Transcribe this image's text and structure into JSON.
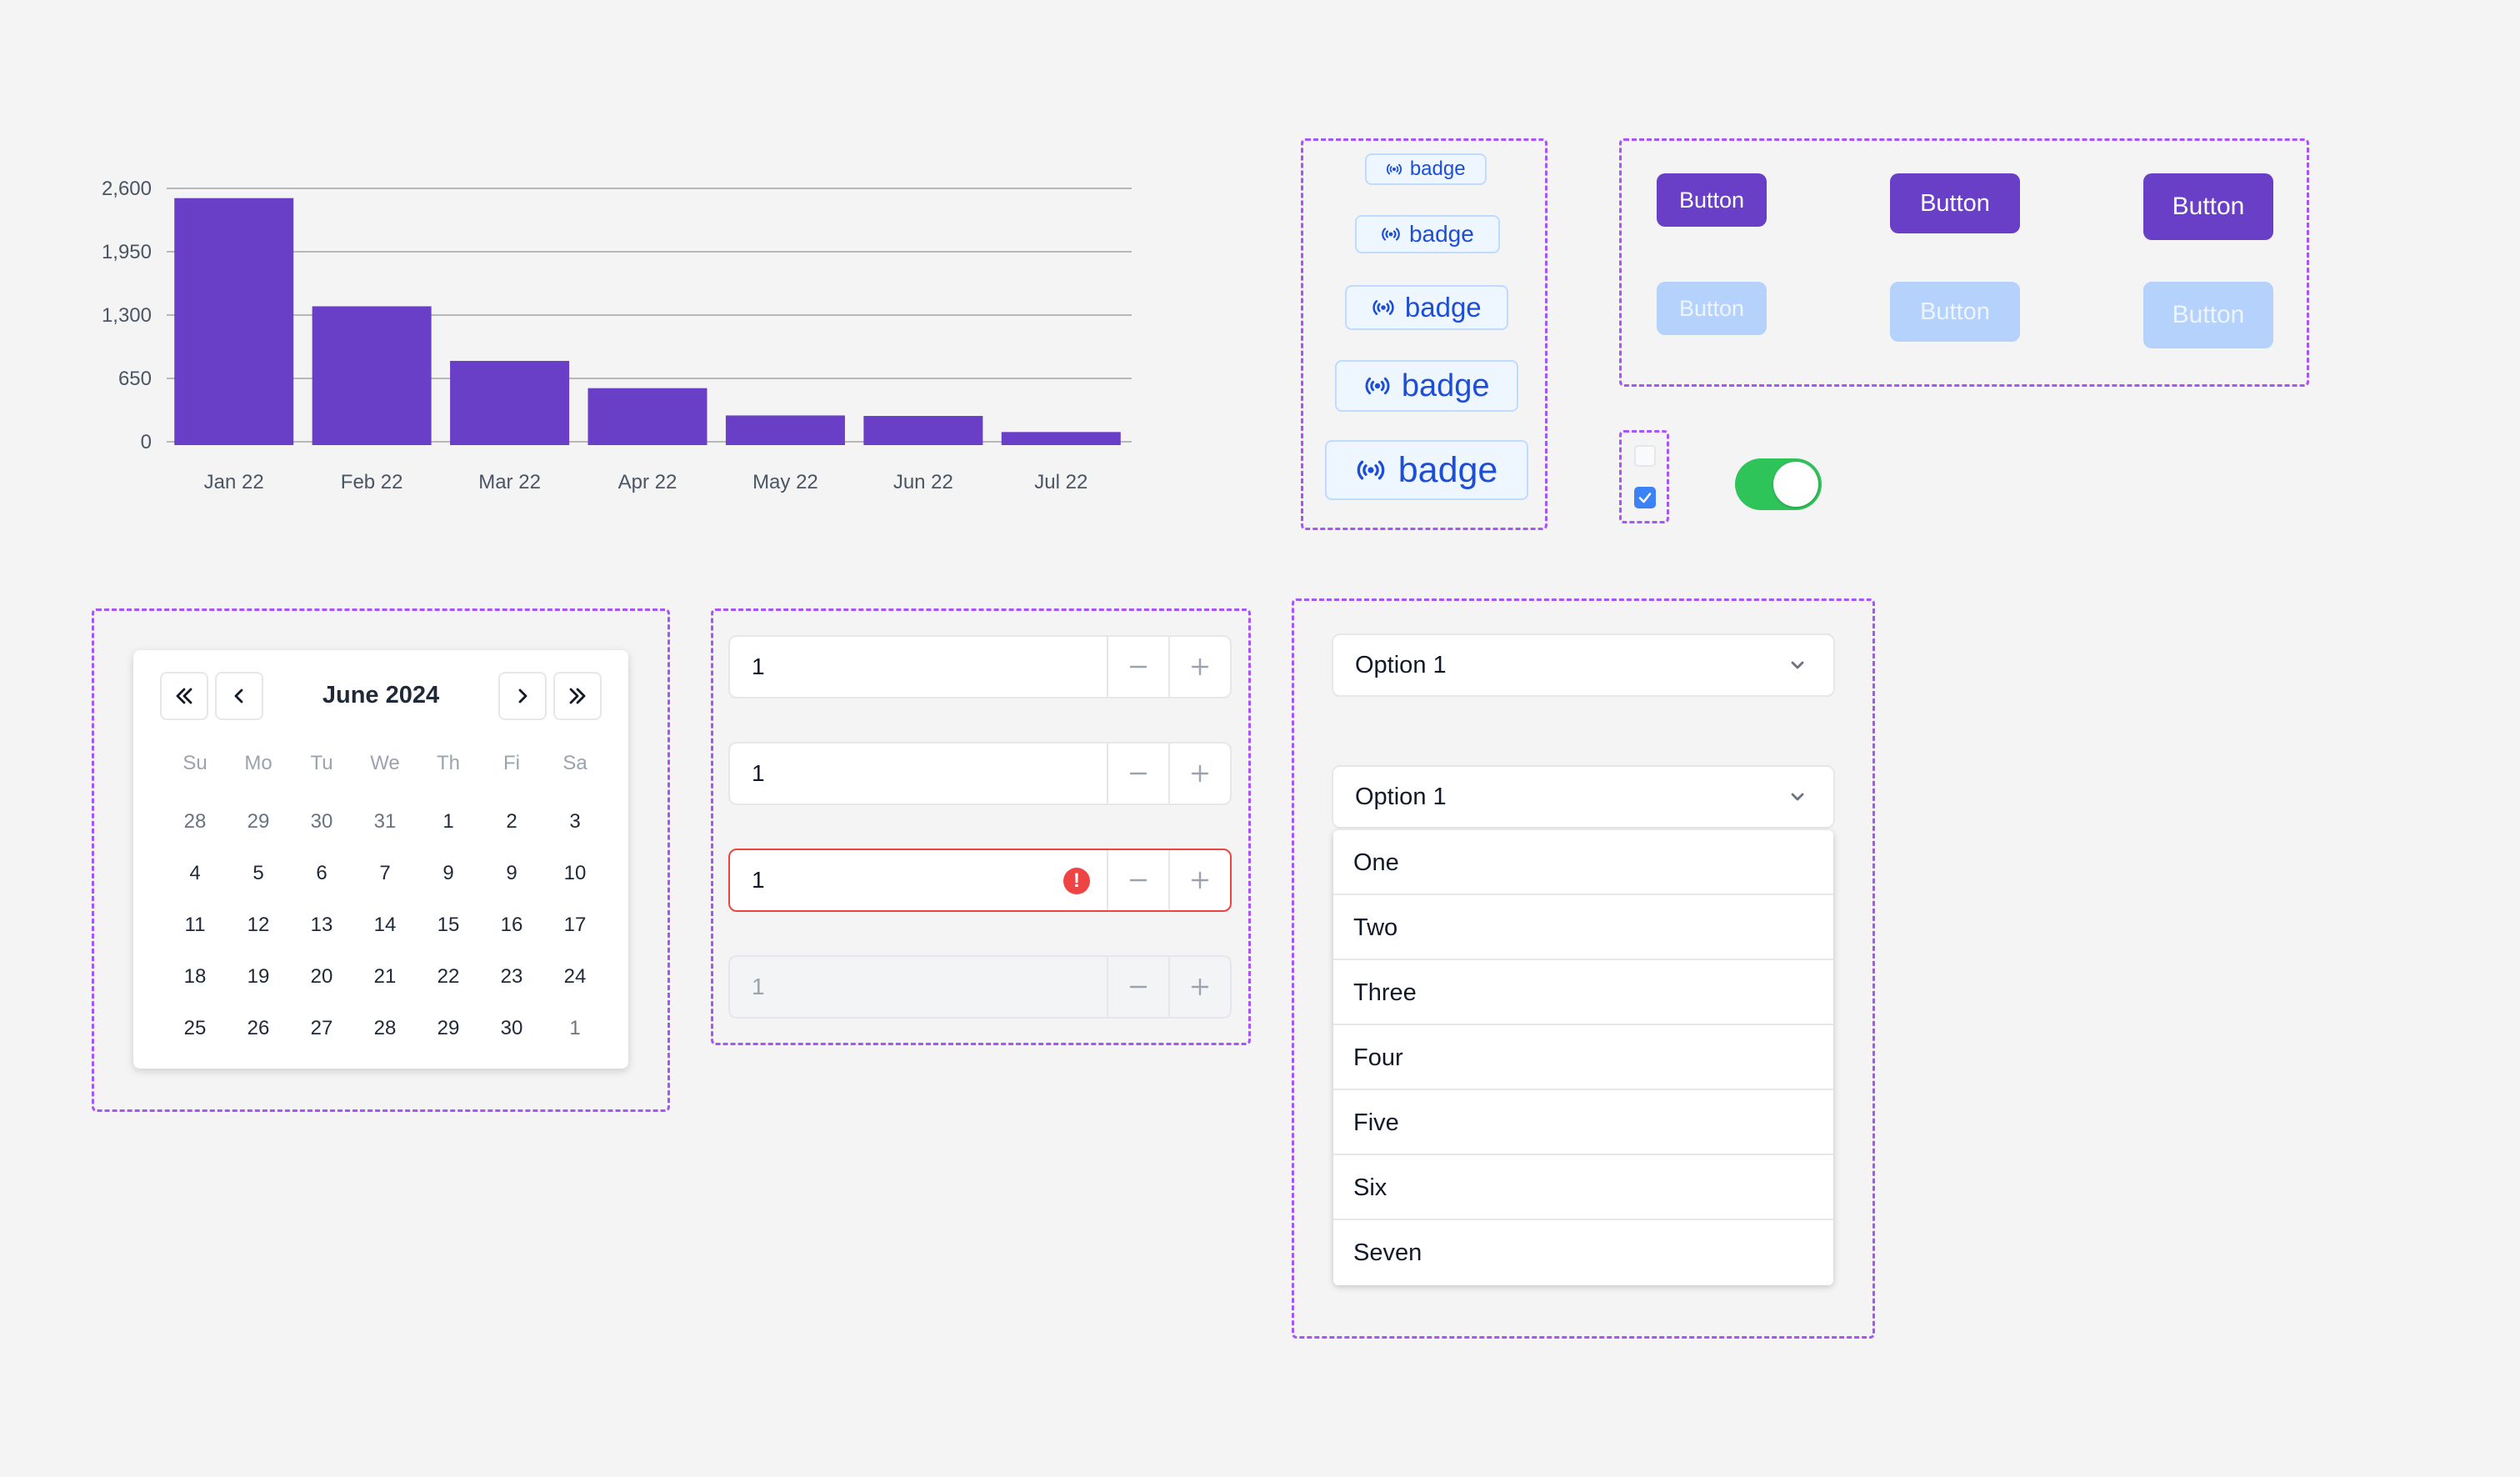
{
  "chart_data": {
    "type": "bar",
    "categories": [
      "Jan 22",
      "Feb 22",
      "Mar 22",
      "Apr 22",
      "May 22",
      "Jun 22",
      "Jul 22"
    ],
    "values": [
      2500,
      1390,
      830,
      550,
      270,
      265,
      100
    ],
    "yticks": [
      "0",
      "650",
      "1,300",
      "1,950",
      "2,600"
    ],
    "ylim": [
      0,
      2600
    ],
    "grid": true,
    "color": "#6a3fc8"
  },
  "badges": [
    {
      "label": "badge"
    },
    {
      "label": "badge"
    },
    {
      "label": "badge"
    },
    {
      "label": "badge"
    },
    {
      "label": "badge"
    }
  ],
  "buttons": {
    "primary": [
      "Button",
      "Button",
      "Button"
    ],
    "disabled": [
      "Button",
      "Button",
      "Button"
    ]
  },
  "checkboxes": {
    "first_checked": false,
    "second_checked": true
  },
  "toggle": {
    "on": true,
    "color": "#2fc45a"
  },
  "calendar": {
    "title": "June 2024",
    "weekdays": [
      "Su",
      "Mo",
      "Tu",
      "We",
      "Th",
      "Fi",
      "Sa"
    ],
    "days": [
      "28",
      "29",
      "30",
      "31",
      "1",
      "2",
      "3",
      "4",
      "5",
      "6",
      "7",
      "9",
      "9",
      "10",
      "11",
      "12",
      "13",
      "14",
      "15",
      "16",
      "17",
      "18",
      "19",
      "20",
      "21",
      "22",
      "23",
      "24",
      "25",
      "26",
      "27",
      "28",
      "29",
      "30",
      "1"
    ],
    "outside_month": [
      0,
      1,
      2,
      3,
      34
    ]
  },
  "number_inputs": [
    {
      "value": "1",
      "state": "default"
    },
    {
      "value": "1",
      "state": "default"
    },
    {
      "value": "1",
      "state": "error"
    },
    {
      "value": "1",
      "state": "disabled"
    }
  ],
  "selects": [
    {
      "value": "Option 1"
    },
    {
      "value": "Option 1",
      "open": true
    }
  ],
  "menu_options": [
    "One",
    "Two",
    "Three",
    "Four",
    "Five",
    "Six",
    "Seven"
  ]
}
